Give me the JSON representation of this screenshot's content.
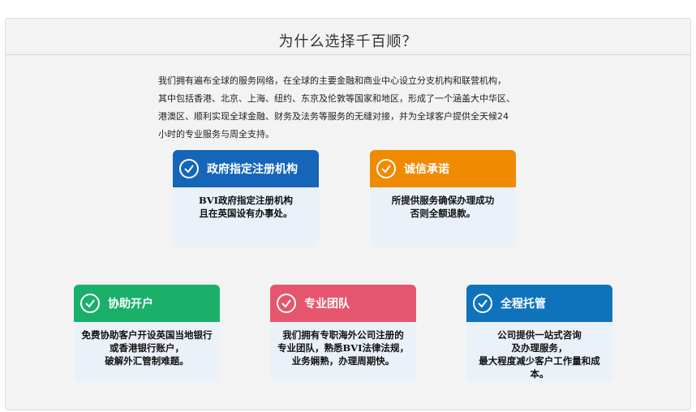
{
  "header": {
    "title": "为什么选择千百顺？"
  },
  "intro": {
    "lines": [
      "我们拥有遍布全球的服务网络，在全球的主要金融和商业中心设立分支机构和联营机构，",
      "其中包括香港、北京、上海、纽约、东京及伦敦等国家和地区，形成了一个涵盖大中华区、",
      "港澳区、顺利实现全球金融、财务及法务等服务的无缝对接，并为全球客户提供全天候24",
      "小时的专业服务与周全支持。"
    ]
  },
  "cards": [
    {
      "title": "政府指定注册机构",
      "color": "#1565b8",
      "lines": [
        "BVI政府指定注册机构",
        "且在英国设有办事处。"
      ]
    },
    {
      "title": "诚信承诺",
      "color": "#f08a00",
      "lines": [
        "所提供服务确保办理成功",
        "否则全额退款。"
      ]
    },
    {
      "title": "协助开户",
      "color": "#1ab06a",
      "lines": [
        "免费协助客户开设英国当地银行",
        "或香港银行账户，",
        "破解外汇管制难题。"
      ]
    },
    {
      "title": "专业团队",
      "color": "#e5566e",
      "lines": [
        "我们拥有专职海外公司注册的",
        "专业团队，熟悉BVI法律法规，",
        "业务娴熟，办理周期快。"
      ]
    },
    {
      "title": "全程托管",
      "color": "#0f73bc",
      "lines": [
        "公司提供一站式咨询",
        "及办理服务，",
        "最大程度减少客户工作量和成",
        "本。"
      ]
    }
  ]
}
